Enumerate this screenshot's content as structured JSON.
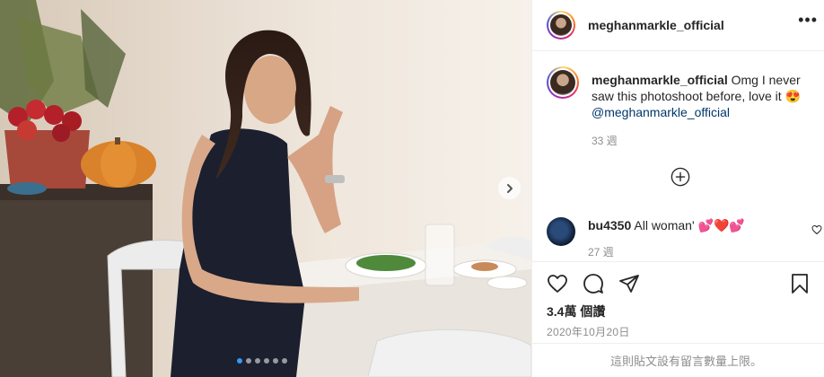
{
  "post": {
    "author": "meghanmarkle_official",
    "more_icon": "more-horizontal-icon",
    "carousel": {
      "total_slides": 6,
      "active_index": 0,
      "next_icon": "chevron-right-icon"
    },
    "comments": [
      {
        "username": "meghanmarkle_official",
        "text": "Omg I never saw this photoshoot before, love it 😍",
        "mention": "@meghanmarkle_official",
        "time": "33 週"
      },
      {
        "username": "bu4350",
        "text": "All woman' 💕❤️💕",
        "time": "27 週"
      }
    ],
    "load_more_icon": "plus-circle-icon",
    "likes": "3.4萬 個讚",
    "date": "2020年10月20日",
    "comments_disabled_notice": "這則貼文設有留言數量上限。"
  },
  "colors": {
    "accent": "#3897f0",
    "mention": "#00376b",
    "muted": "#8e8e8e",
    "text": "#262626",
    "border": "#efefef"
  }
}
